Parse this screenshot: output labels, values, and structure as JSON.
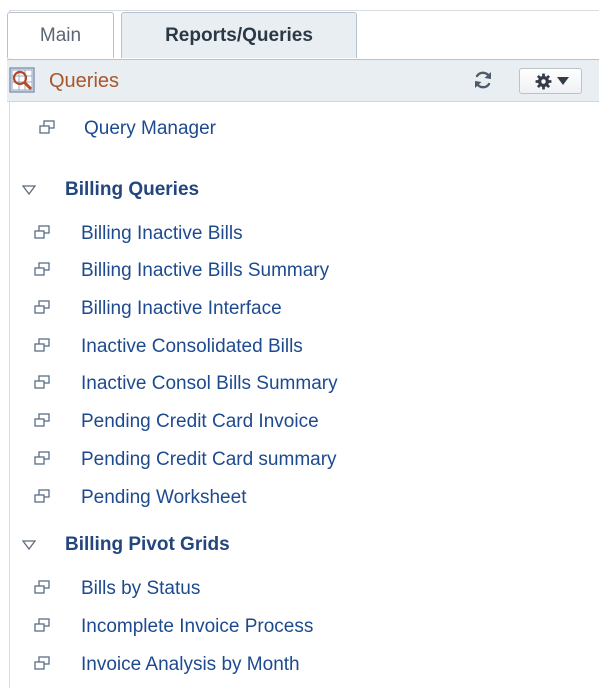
{
  "tabs": [
    {
      "label": "Main",
      "active": false
    },
    {
      "label": "Reports/Queries",
      "active": true
    }
  ],
  "pagelet": {
    "title": "Queries",
    "title_icon": "query-pagelet-icon",
    "refresh_icon": "refresh-icon",
    "menu_icon": "gear-icon",
    "menu_arrow_icon": "chevron-down-icon"
  },
  "top_link": {
    "label": "Query Manager",
    "icon": "link-icon"
  },
  "folders": [
    {
      "label": "Billing Queries",
      "expanded": true,
      "icon": "collapse-triangle-icon",
      "items": [
        {
          "label": "Billing Inactive Bills"
        },
        {
          "label": "Billing Inactive Bills Summary"
        },
        {
          "label": "Billing Inactive Interface"
        },
        {
          "label": "Inactive Consolidated Bills"
        },
        {
          "label": "Inactive Consol Bills Summary"
        },
        {
          "label": "Pending Credit Card Invoice"
        },
        {
          "label": "Pending Credit Card summary"
        },
        {
          "label": "Pending Worksheet"
        }
      ]
    },
    {
      "label": "Billing Pivot Grids",
      "expanded": true,
      "icon": "collapse-triangle-icon",
      "items": [
        {
          "label": "Bills by Status"
        },
        {
          "label": "Incomplete Invoice Process"
        },
        {
          "label": "Invoice Analysis by Month"
        }
      ]
    }
  ],
  "colors": {
    "link": "#1d4a8f",
    "folder": "#22467d",
    "title": "#a8572a",
    "header_bg": "#e9eef3"
  }
}
